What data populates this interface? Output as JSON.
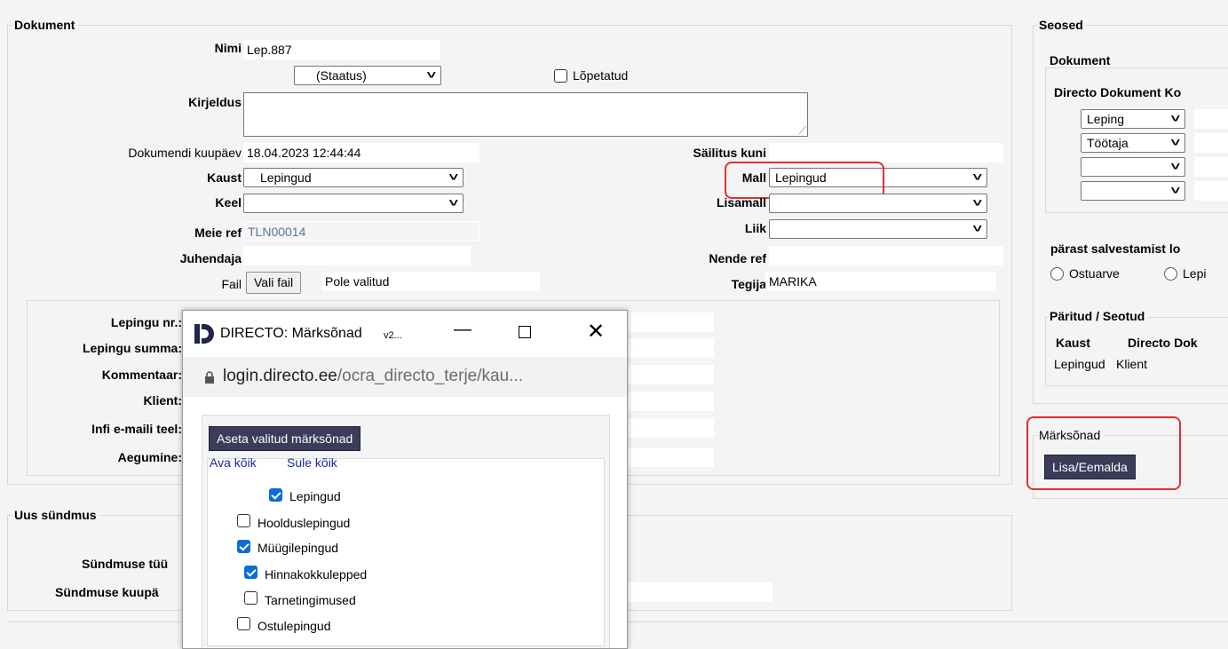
{
  "dokument": {
    "legend": "Dokument",
    "nimi_label": "Nimi",
    "nimi_value": "Lep.887",
    "staatus_value": "(Staatus)",
    "lopetatud_label": "Lõpetatud",
    "kirjeldus_label": "Kirjeldus",
    "kuupaev_label": "Dokumendi kuupäev",
    "kuupaev_value": "18.04.2023 12:44:44",
    "sailitus_label": "Säilitus kuni",
    "kaust_label": "Kaust",
    "kaust_value": "Lepingud",
    "mall_label": "Mall",
    "mall_value": "Lepingud",
    "keel_label": "Keel",
    "lisamall_label": "Lisamall",
    "meieref_label": "Meie ref",
    "meieref_value": "TLN00014",
    "liik_label": "Liik",
    "juhendaja_label": "Juhendaja",
    "nenderef_label": "Nende ref",
    "fail_label": "Fail",
    "vali_fail_button": "Vali fail",
    "fail_status": "Pole valitud",
    "tegija_label": "Tegija",
    "tegija_value": "MARIKA"
  },
  "lepingu": {
    "nr_label": "Lepingu nr.:",
    "summa_label": "Lepingu summa:",
    "kommentaar_label": "Kommentaar:",
    "klient_label": "Klient:",
    "infi_label": "Infi e-maili teel:",
    "aegumine_label": "Aegumine:"
  },
  "sundmus": {
    "legend": "Uus sündmus",
    "tuup_label": "Sündmuse tüü",
    "kuupaev_label": "Sündmuse kuupä"
  },
  "seosed": {
    "legend": "Seosed",
    "dokument_legend": "Dokument",
    "directo_header": "Directo Dokument Ko",
    "rows": [
      "Leping",
      "Töötaja",
      "",
      ""
    ],
    "parast_text": "pärast salvestamist lo",
    "radio1": "Ostuarve",
    "radio2": "Lepi"
  },
  "paritud": {
    "legend": "Päritud / Seotud",
    "col1": "Kaust",
    "col2": "Directo Dok",
    "row_kaust": "Lepingud",
    "row_dok": "Klient"
  },
  "marksonad": {
    "legend": "Märksõnad",
    "button": "Lisa/Eemalda"
  },
  "popup": {
    "title": "DIRECTO: Märksõnad",
    "title_suffix": "v2...",
    "url_host": "login.directo.ee",
    "url_path": "/ocra_directo_terje/kau...",
    "apply_button": "Aseta valitud märksõnad",
    "open_all": "Ava kõik",
    "close_all": "Sule kõik",
    "items": [
      {
        "label": "Lepingud",
        "checked": true
      },
      {
        "label": "Hoolduslepingud",
        "checked": false
      },
      {
        "label": "Müügilepingud",
        "checked": true
      },
      {
        "label": "Hinnakokkulepped",
        "checked": true
      },
      {
        "label": "Tarnetingimused",
        "checked": false
      },
      {
        "label": "Ostulepingud",
        "checked": false
      }
    ]
  },
  "colors": {
    "highlight": "#e03030",
    "button": "#3b3b5a",
    "checkbox": "#0a6cd8"
  }
}
